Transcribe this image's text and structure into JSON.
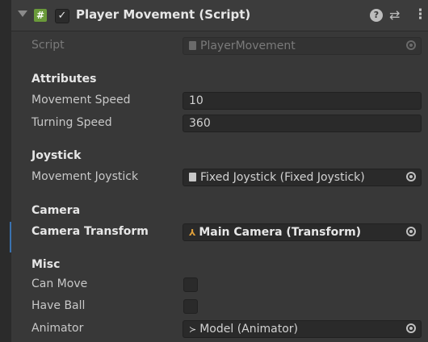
{
  "header": {
    "title": "Player Movement (Script)",
    "script_icon_glyph": "#",
    "enabled_check": "✓",
    "help_glyph": "?",
    "presets_glyph": "⇄",
    "more_glyph": "⋮"
  },
  "script_row": {
    "label": "Script",
    "value": "PlayerMovement"
  },
  "sections": {
    "attributes": "Attributes",
    "joystick": "Joystick",
    "camera": "Camera",
    "misc": "Misc"
  },
  "fields": {
    "movement_speed": {
      "label": "Movement Speed",
      "value": "10"
    },
    "turning_speed": {
      "label": "Turning Speed",
      "value": "360"
    },
    "movement_joystick": {
      "label": "Movement Joystick",
      "value": "Fixed Joystick (Fixed Joystick)"
    },
    "camera_transform": {
      "label": "Camera Transform",
      "value": "Main Camera (Transform)",
      "icon": "⅄"
    },
    "can_move": {
      "label": "Can Move",
      "checked": false
    },
    "have_ball": {
      "label": "Have Ball",
      "checked": false
    },
    "animator": {
      "label": "Animator",
      "value": "Model (Animator)",
      "icon": "≻"
    }
  },
  "colors": {
    "background": "#383838",
    "field": "#2a2a2a",
    "accent": "#3a72b0",
    "script_icon": "#6a9a3a"
  }
}
